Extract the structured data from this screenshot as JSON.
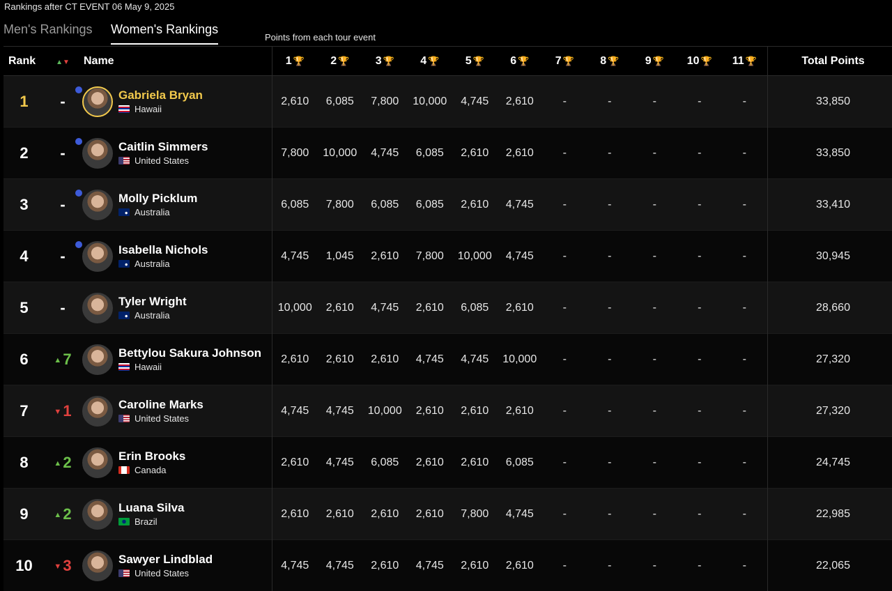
{
  "header": {
    "subtitle": "Rankings after CT EVENT 06 May 9, 2025",
    "tabs": [
      "Men's Rankings",
      "Women's Rankings"
    ],
    "active_tab": "Women's Rankings",
    "points_note": "Points from each tour event"
  },
  "columns": {
    "rank": "Rank",
    "name": "Name",
    "events": [
      "1",
      "2",
      "3",
      "4",
      "5",
      "6",
      "7",
      "8",
      "9",
      "10",
      "11"
    ],
    "trophy_icon": "trophy-icon",
    "total": "Total Points"
  },
  "colors": {
    "leader_gold": "#f2c94c",
    "up_green": "#6cbf4a",
    "down_red": "#e0413e",
    "indicator_blue": "#3d5bd9"
  },
  "rows": [
    {
      "rank": "1",
      "move_dir": "same",
      "move": "-",
      "name": "Gabriela Bryan",
      "country": "Hawaii",
      "flag": "hawaii",
      "indicator": true,
      "leader": true,
      "points": [
        "2,610",
        "6,085",
        "7,800",
        "10,000",
        "4,745",
        "2,610",
        "-",
        "-",
        "-",
        "-",
        "-"
      ],
      "total": "33,850"
    },
    {
      "rank": "2",
      "move_dir": "same",
      "move": "-",
      "name": "Caitlin Simmers",
      "country": "United States",
      "flag": "us",
      "indicator": true,
      "leader": false,
      "points": [
        "7,800",
        "10,000",
        "4,745",
        "6,085",
        "2,610",
        "2,610",
        "-",
        "-",
        "-",
        "-",
        "-"
      ],
      "total": "33,850"
    },
    {
      "rank": "3",
      "move_dir": "same",
      "move": "-",
      "name": "Molly Picklum",
      "country": "Australia",
      "flag": "au",
      "indicator": true,
      "leader": false,
      "points": [
        "6,085",
        "7,800",
        "6,085",
        "6,085",
        "2,610",
        "4,745",
        "-",
        "-",
        "-",
        "-",
        "-"
      ],
      "total": "33,410"
    },
    {
      "rank": "4",
      "move_dir": "same",
      "move": "-",
      "name": "Isabella Nichols",
      "country": "Australia",
      "flag": "au",
      "indicator": true,
      "leader": false,
      "points": [
        "4,745",
        "1,045",
        "2,610",
        "7,800",
        "10,000",
        "4,745",
        "-",
        "-",
        "-",
        "-",
        "-"
      ],
      "total": "30,945"
    },
    {
      "rank": "5",
      "move_dir": "same",
      "move": "-",
      "name": "Tyler Wright",
      "country": "Australia",
      "flag": "au",
      "indicator": false,
      "leader": false,
      "points": [
        "10,000",
        "2,610",
        "4,745",
        "2,610",
        "6,085",
        "2,610",
        "-",
        "-",
        "-",
        "-",
        "-"
      ],
      "total": "28,660"
    },
    {
      "rank": "6",
      "move_dir": "up",
      "move": "7",
      "name": "Bettylou Sakura Johnson",
      "country": "Hawaii",
      "flag": "hawaii",
      "indicator": false,
      "leader": false,
      "points": [
        "2,610",
        "2,610",
        "2,610",
        "4,745",
        "4,745",
        "10,000",
        "-",
        "-",
        "-",
        "-",
        "-"
      ],
      "total": "27,320"
    },
    {
      "rank": "7",
      "move_dir": "down",
      "move": "1",
      "name": "Caroline Marks",
      "country": "United States",
      "flag": "us",
      "indicator": false,
      "leader": false,
      "points": [
        "4,745",
        "4,745",
        "10,000",
        "2,610",
        "2,610",
        "2,610",
        "-",
        "-",
        "-",
        "-",
        "-"
      ],
      "total": "27,320"
    },
    {
      "rank": "8",
      "move_dir": "up",
      "move": "2",
      "name": "Erin Brooks",
      "country": "Canada",
      "flag": "ca",
      "indicator": false,
      "leader": false,
      "points": [
        "2,610",
        "4,745",
        "6,085",
        "2,610",
        "2,610",
        "6,085",
        "-",
        "-",
        "-",
        "-",
        "-"
      ],
      "total": "24,745"
    },
    {
      "rank": "9",
      "move_dir": "up",
      "move": "2",
      "name": "Luana Silva",
      "country": "Brazil",
      "flag": "br",
      "indicator": false,
      "leader": false,
      "points": [
        "2,610",
        "2,610",
        "2,610",
        "2,610",
        "7,800",
        "4,745",
        "-",
        "-",
        "-",
        "-",
        "-"
      ],
      "total": "22,985"
    },
    {
      "rank": "10",
      "move_dir": "down",
      "move": "3",
      "name": "Sawyer Lindblad",
      "country": "United States",
      "flag": "us",
      "indicator": false,
      "leader": false,
      "points": [
        "4,745",
        "4,745",
        "2,610",
        "4,745",
        "2,610",
        "2,610",
        "-",
        "-",
        "-",
        "-",
        "-"
      ],
      "total": "22,065"
    }
  ]
}
